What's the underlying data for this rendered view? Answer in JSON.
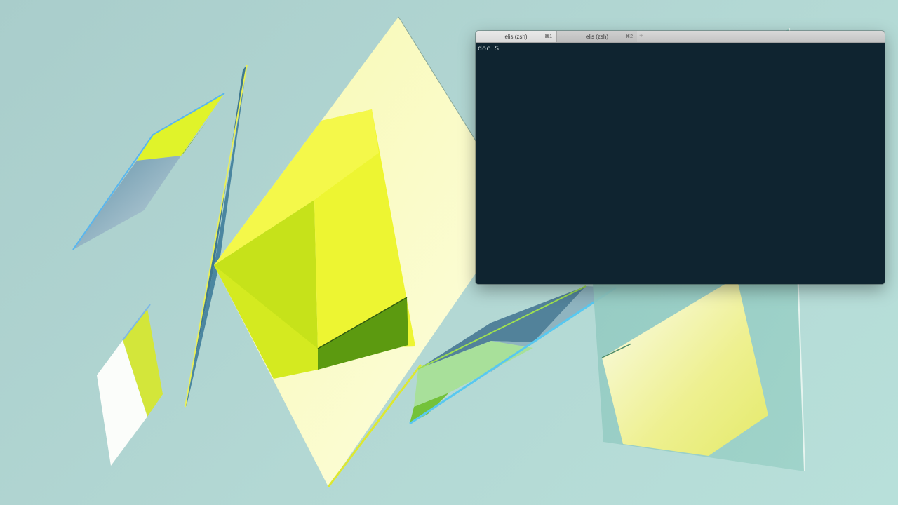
{
  "terminal": {
    "tabs": [
      {
        "title": "elis (zsh)",
        "shortcut": "⌘1",
        "active": true
      },
      {
        "title": "elis (zsh)",
        "shortcut": "⌘2",
        "active": false
      }
    ],
    "new_tab_symbol": "+",
    "prompt": {
      "directory": "doc",
      "symbol": "$",
      "input": ""
    },
    "background_color": "#0f2430",
    "text_color": "#c9d3d6"
  },
  "wallpaper": {
    "colors": {
      "background": "#b3d8d4",
      "yellow": "#eef533",
      "pale_yellow": "#fbfcc4",
      "dark_green": "#5d9e12",
      "slate_blue": "#4f7f96",
      "cyan_edge": "#58c8f0"
    }
  }
}
